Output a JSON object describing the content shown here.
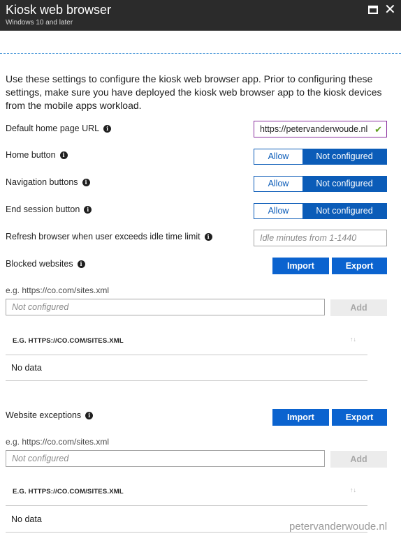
{
  "window": {
    "title": "Kiosk web browser",
    "subtitle": "Windows 10 and later"
  },
  "intro": "Use these settings to configure the kiosk web browser app. Prior to configuring these settings, make sure you have deployed the kiosk web browser app to the kiosk devices from the mobile apps workload.",
  "settings": {
    "home_url": {
      "label": "Default home page URL",
      "value": "https://petervanderwoude.nl"
    },
    "home_button": {
      "label": "Home button",
      "allow": "Allow",
      "not_configured": "Not configured",
      "selected": "Not configured"
    },
    "navigation_buttons": {
      "label": "Navigation buttons",
      "allow": "Allow",
      "not_configured": "Not configured",
      "selected": "Not configured"
    },
    "end_session_button": {
      "label": "End session button",
      "allow": "Allow",
      "not_configured": "Not configured",
      "selected": "Not configured"
    },
    "refresh": {
      "label": "Refresh browser when user exceeds idle time limit",
      "placeholder": "Idle minutes from 1-1440"
    }
  },
  "blocked_websites": {
    "label": "Blocked websites",
    "import_label": "Import",
    "export_label": "Export",
    "hint": "e.g. https://co.com/sites.xml",
    "input_placeholder": "Not configured",
    "add_label": "Add",
    "column_header": "E.G. HTTPS://CO.COM/SITES.XML",
    "empty_text": "No data"
  },
  "website_exceptions": {
    "label": "Website exceptions",
    "import_label": "Import",
    "export_label": "Export",
    "hint": "e.g. https://co.com/sites.xml",
    "input_placeholder": "Not configured",
    "add_label": "Add",
    "column_header": "E.G. HTTPS://CO.COM/SITES.XML",
    "empty_text": "No data"
  },
  "watermark": "petervanderwoude.nl",
  "colors": {
    "titlebar": "#2b2b2b",
    "accent": "#0b63cf",
    "focus_border": "#8a2f9e",
    "valid_check": "#5d9e1a"
  },
  "icons": [
    "maximize-icon",
    "close-icon",
    "info-icon",
    "check-icon",
    "sort-icon"
  ]
}
